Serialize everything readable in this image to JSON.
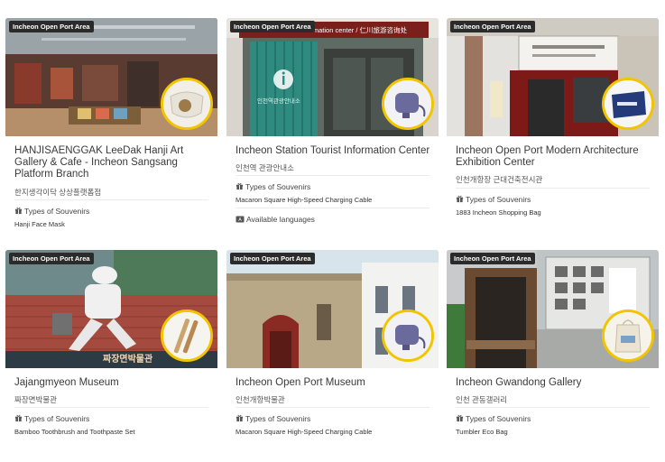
{
  "area_label": "Incheon Open Port Area",
  "types_label": "Types of Souvenirs",
  "cards": [
    {
      "name": "HANJISAENGGAK LeeDak Hanji Art Gallery & Cafe - Incheon Sangsang Platform Branch",
      "name_ko": "한지생각이닥 상상플랫폼점",
      "souvenir": "Hanji Face Mask"
    },
    {
      "name": "Incheon Station Tourist Information Center",
      "name_ko": "인천역 관광안내소",
      "souvenir": "Macaron Square High-Speed Charging Cable",
      "extra": "Available languages",
      "sign": "Incheon tourist information center / 仁川旅游咨询处",
      "sign_ko": "인천역관광안내소"
    },
    {
      "name": "Incheon Open Port Modern Architecture Exhibition Center",
      "name_ko": "인천개항장 근대건축전시관",
      "souvenir": "1883 Incheon Shopping Bag"
    },
    {
      "name": "Jajangmyeon Museum",
      "name_ko": "짜장면박물관",
      "souvenir": "Bamboo Toothbrush and Toothpaste Set",
      "sign": "짜장면박물관"
    },
    {
      "name": "Incheon Open Port Museum",
      "name_ko": "인천개항박물관",
      "souvenir": "Macaron Square High-Speed Charging Cable"
    },
    {
      "name": "Incheon Gwandong Gallery",
      "name_ko": "인천 관동갤러리",
      "souvenir": "Tumbler Eco Bag"
    }
  ]
}
